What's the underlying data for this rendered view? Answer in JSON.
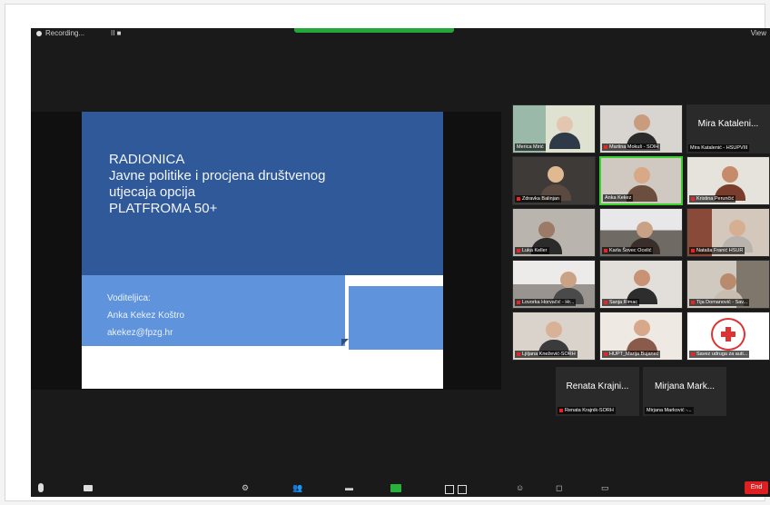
{
  "window": {
    "recording_label": "Recording...",
    "recording_controls": "II ■",
    "view_button": "View"
  },
  "slide": {
    "title_lines": [
      "RADIONICA",
      "Javne politike i procjena društvenog",
      "utjecaja opcija",
      "PLATFROMA 50+"
    ],
    "presenter_heading": "Voditeljica:",
    "presenter_name": "Anka Kekez Koštro",
    "presenter_email": "akekez@fpzg.hr"
  },
  "participants": [
    {
      "label": "Merica Mirić",
      "muted": false
    },
    {
      "label": "Martina Mokuš - SOIH",
      "muted": true
    },
    {
      "label": "Mira Katalenić - HSUPVIII",
      "big_name": "Mira Kataleni...",
      "muted": false
    },
    {
      "label": "Zdravka Balinjan",
      "muted": true
    },
    {
      "label": "Anka Kekez",
      "muted": false,
      "active": true
    },
    {
      "label": "Kristina Perunčić",
      "muted": true
    },
    {
      "label": "Luka Keller",
      "muted": true
    },
    {
      "label": "Karla Šovec Ocelić",
      "muted": true
    },
    {
      "label": "Nataša Franić HSUR",
      "muted": true
    },
    {
      "label": "Lovorka Horvačić - Hr...",
      "muted": true
    },
    {
      "label": "Sanja Rimac",
      "muted": true
    },
    {
      "label": "Tija Domanović - Sav...",
      "muted": true
    },
    {
      "label": "Ljiljana Knežević-SORH",
      "muted": true
    },
    {
      "label": "HUPT_Marija Bujanec",
      "muted": true
    },
    {
      "label": "Savez udruga za auti...",
      "muted": true
    },
    {
      "label": "Renata Krajnik-SORH",
      "big_name": "Renata Krajni...",
      "muted": true
    },
    {
      "label": "Mirjana Marković -...",
      "big_name": "Mirjana Mark...",
      "muted": false
    }
  ],
  "toolbar": {
    "end_label": "End"
  },
  "colors": {
    "slide_blue": "#30599a",
    "ribbon_blue": "#5f93db",
    "active_speaker": "#3bd12e",
    "end_red": "#e02020"
  }
}
